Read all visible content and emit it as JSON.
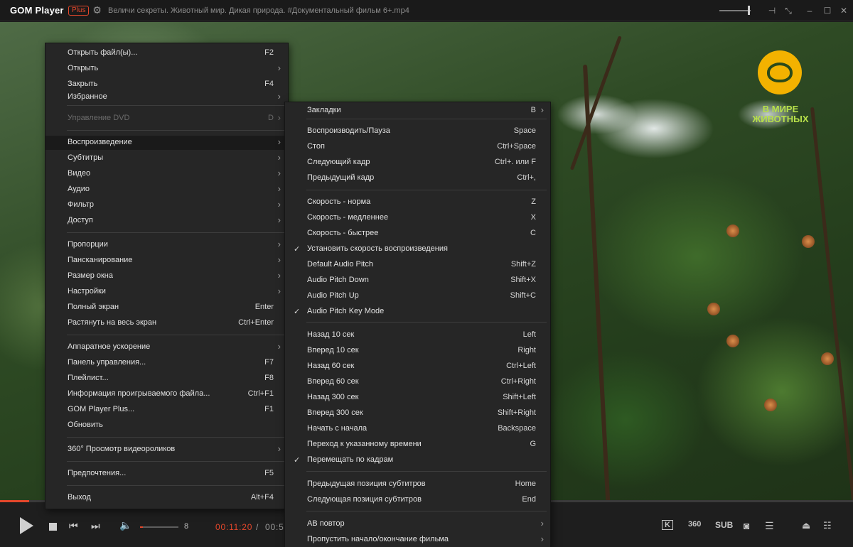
{
  "titlebar": {
    "app_name": "GOM Player",
    "plus_badge": "Plus",
    "file_title": "Величи секреты. Животный мир. Дикая природа. #Документальный фильм 6+.mp4",
    "icons": [
      "gear-icon",
      "pin-icon",
      "fullscreen-icon",
      "minimize-icon",
      "maximize-icon",
      "close-icon"
    ]
  },
  "video": {
    "logo_text_line1": "В МИРЕ",
    "logo_text_line2": "ЖИВОТНЫХ"
  },
  "playback": {
    "progress_fraction": 0.034,
    "volume_value": "8",
    "current_time": "00:11:20",
    "time_separator": "/",
    "total_time": "00:5",
    "accent_color": "#e4472b"
  },
  "controls_right": {
    "kv_label": "K",
    "vr_label": "360",
    "sub_label": "SUB"
  },
  "main_menu": {
    "items": [
      {
        "label": "Открыть файл(ы)...",
        "shortcut": "F2",
        "arrow": ""
      },
      {
        "label": "Открыть",
        "shortcut": "",
        "arrow": "›"
      },
      {
        "label": "Закрыть",
        "shortcut": "F4",
        "arrow": ""
      },
      {
        "label": "Избранное",
        "shortcut": "",
        "arrow": "›"
      },
      {
        "label": "Управление DVD",
        "shortcut": "D",
        "arrow": "›"
      },
      {
        "label": "Воспроизведение",
        "shortcut": "",
        "arrow": "›"
      },
      {
        "label": "Субтитры",
        "shortcut": "",
        "arrow": "›"
      },
      {
        "label": "Видео",
        "shortcut": "",
        "arrow": "›"
      },
      {
        "label": "Аудио",
        "shortcut": "",
        "arrow": "›"
      },
      {
        "label": "Фильтр",
        "shortcut": "",
        "arrow": "›"
      },
      {
        "label": "Доступ",
        "shortcut": "",
        "arrow": "›"
      },
      {
        "label": "Пропорции",
        "shortcut": "",
        "arrow": "›"
      },
      {
        "label": "Пансканирование",
        "shortcut": "",
        "arrow": "›"
      },
      {
        "label": "Размер окна",
        "shortcut": "",
        "arrow": "›"
      },
      {
        "label": "Настройки",
        "shortcut": "",
        "arrow": "›"
      },
      {
        "label": "Полный экран",
        "shortcut": "Enter",
        "arrow": ""
      },
      {
        "label": "Растянуть на весь экран",
        "shortcut": "Ctrl+Enter",
        "arrow": ""
      },
      {
        "label": "Аппаратное ускорение",
        "shortcut": "",
        "arrow": "›"
      },
      {
        "label": "Панель управления...",
        "shortcut": "F7",
        "arrow": ""
      },
      {
        "label": "Плейлист...",
        "shortcut": "F8",
        "arrow": ""
      },
      {
        "label": "Информация проигрываемого файла...",
        "shortcut": "Ctrl+F1",
        "arrow": ""
      },
      {
        "label": "GOM Player Plus...",
        "shortcut": "F1",
        "arrow": ""
      },
      {
        "label": "Обновить",
        "shortcut": "",
        "arrow": ""
      },
      {
        "label": "360° Просмотр видеороликов",
        "shortcut": "",
        "arrow": "›"
      },
      {
        "label": "Предпочтения...",
        "shortcut": "F5",
        "arrow": ""
      },
      {
        "label": "Выход",
        "shortcut": "Alt+F4",
        "arrow": ""
      }
    ]
  },
  "playback_submenu": {
    "items": [
      {
        "label": "Закладки",
        "shortcut": "B",
        "arrow": "›",
        "check": ""
      },
      {
        "label": "Воспроизводить/Пауза",
        "shortcut": "Space",
        "arrow": "",
        "check": ""
      },
      {
        "label": "Стоп",
        "shortcut": "Ctrl+Space",
        "arrow": "",
        "check": ""
      },
      {
        "label": "Следующий кадр",
        "shortcut": "Ctrl+. или F",
        "arrow": "",
        "check": ""
      },
      {
        "label": "Предыдущий кадр",
        "shortcut": "Ctrl+,",
        "arrow": "",
        "check": ""
      },
      {
        "label": "Скорость - норма",
        "shortcut": "Z",
        "arrow": "",
        "check": ""
      },
      {
        "label": "Скорость - медленнее",
        "shortcut": "X",
        "arrow": "",
        "check": ""
      },
      {
        "label": "Скорость - быстрее",
        "shortcut": "C",
        "arrow": "",
        "check": ""
      },
      {
        "label": "Установить скорость воспроизведения",
        "shortcut": "",
        "arrow": "",
        "check": "✓"
      },
      {
        "label": "Default Audio Pitch",
        "shortcut": "Shift+Z",
        "arrow": "",
        "check": ""
      },
      {
        "label": "Audio Pitch Down",
        "shortcut": "Shift+X",
        "arrow": "",
        "check": ""
      },
      {
        "label": "Audio Pitch Up",
        "shortcut": "Shift+C",
        "arrow": "",
        "check": ""
      },
      {
        "label": "Audio Pitch Key Mode",
        "shortcut": "",
        "arrow": "",
        "check": "✓"
      },
      {
        "label": "Назад 10 сек",
        "shortcut": "Left",
        "arrow": "",
        "check": ""
      },
      {
        "label": "Вперед 10 сек",
        "shortcut": "Right",
        "arrow": "",
        "check": ""
      },
      {
        "label": "Назад 60 сек",
        "shortcut": "Ctrl+Left",
        "arrow": "",
        "check": ""
      },
      {
        "label": "Вперед 60 сек",
        "shortcut": "Ctrl+Right",
        "arrow": "",
        "check": ""
      },
      {
        "label": "Назад 300 сек",
        "shortcut": "Shift+Left",
        "arrow": "",
        "check": ""
      },
      {
        "label": "Вперед 300 сек",
        "shortcut": "Shift+Right",
        "arrow": "",
        "check": ""
      },
      {
        "label": "Начать с начала",
        "shortcut": "Backspace",
        "arrow": "",
        "check": ""
      },
      {
        "label": "Переход к указанному времени",
        "shortcut": "G",
        "arrow": "",
        "check": ""
      },
      {
        "label": "Перемещать по кадрам",
        "shortcut": "",
        "arrow": "",
        "check": "✓"
      },
      {
        "label": "Предыдущая позиция субтитров",
        "shortcut": "Home",
        "arrow": "",
        "check": ""
      },
      {
        "label": "Следующая позиция субтитров",
        "shortcut": "End",
        "arrow": "",
        "check": ""
      },
      {
        "label": "AB повтор",
        "shortcut": "",
        "arrow": "›",
        "check": ""
      },
      {
        "label": "Пропустить начало/окончание фильма",
        "shortcut": "",
        "arrow": "›",
        "check": ""
      }
    ]
  }
}
